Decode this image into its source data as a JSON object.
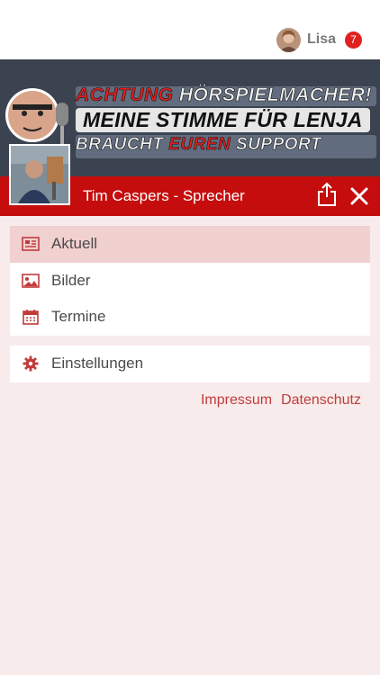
{
  "header": {
    "user_name": "Lisa",
    "notification_count": "7"
  },
  "banner": {
    "line1_red": "ACHTUNG",
    "line1_white": "HÖRSPIELMACHER!",
    "line2": "MEINE STIMME FÜR LENJA",
    "line3_a": "BRAUCHT",
    "line3_b": "EUREN",
    "line3_c": "SUPPORT"
  },
  "page": {
    "title": "Tim Caspers - Sprecher"
  },
  "menu": {
    "items": [
      {
        "label": "Aktuell",
        "icon": "newspaper-icon",
        "active": true
      },
      {
        "label": "Bilder",
        "icon": "image-icon",
        "active": false
      },
      {
        "label": "Termine",
        "icon": "calendar-icon",
        "active": false
      }
    ],
    "settings_label": "Einstellungen"
  },
  "footer": {
    "impressum": "Impressum",
    "datenschutz": "Datenschutz"
  },
  "colors": {
    "accent": "#c50d0d",
    "background": "#f8ebeb",
    "active_item": "#f1d0d0",
    "link": "#c03c3c",
    "badge": "#e02020"
  }
}
